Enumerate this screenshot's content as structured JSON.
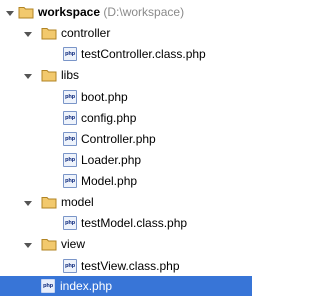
{
  "project": {
    "name": "workspace",
    "path": "(D:\\workspace)"
  },
  "folders": {
    "controller": {
      "name": "controller",
      "files": [
        "testController.class.php"
      ]
    },
    "libs": {
      "name": "libs",
      "files": [
        "boot.php",
        "config.php",
        "Controller.php",
        "Loader.php",
        "Model.php"
      ]
    },
    "model": {
      "name": "model",
      "files": [
        "testModel.class.php"
      ]
    },
    "view": {
      "name": "view",
      "files": [
        "testView.class.php"
      ]
    }
  },
  "root_files": [
    "index.php"
  ],
  "selected_file": "index.php",
  "icons": {
    "expanded": "chevron-down-icon",
    "folder": "folder-icon",
    "php_file": "php-file-icon",
    "php_glyph": "php"
  },
  "colors": {
    "selection": "#3875d7",
    "folder": "#f2c96d",
    "folder_stroke": "#b18424",
    "path_text": "#8a8a8a"
  }
}
